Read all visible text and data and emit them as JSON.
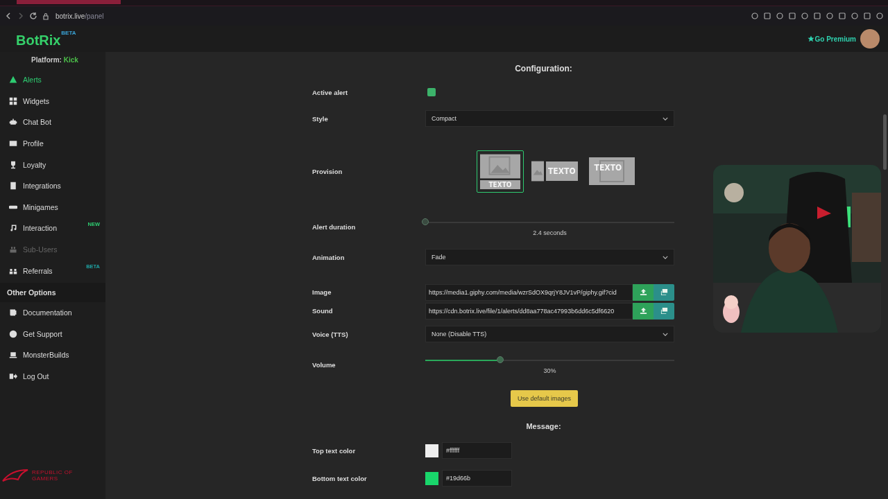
{
  "browser": {
    "url_host": "botrix.live",
    "url_path": "/panel"
  },
  "header": {
    "logo": "BotRix",
    "logo_badge": "BETA",
    "premium": "Go Premium"
  },
  "sidebar": {
    "platform_label": "Platform:",
    "platform_value": "Kick",
    "items": [
      {
        "label": "Alerts",
        "selected": true,
        "disabled": false
      },
      {
        "label": "Widgets",
        "selected": false,
        "disabled": false
      },
      {
        "label": "Chat Bot",
        "selected": false,
        "disabled": false
      },
      {
        "label": "Profile",
        "selected": false,
        "disabled": false
      },
      {
        "label": "Loyalty",
        "selected": false,
        "disabled": false
      },
      {
        "label": "Integrations",
        "selected": false,
        "disabled": false
      },
      {
        "label": "Minigames",
        "selected": false,
        "disabled": false
      },
      {
        "label": "Interaction",
        "selected": false,
        "disabled": false,
        "badge": "NEW",
        "color": "#2ecc71"
      },
      {
        "label": "Sub-Users",
        "selected": false,
        "disabled": true
      },
      {
        "label": "Referrals",
        "selected": false,
        "disabled": false,
        "badge": "BETA",
        "color": "#1fa3a3"
      }
    ],
    "section_title": "Other Options",
    "other_items": [
      {
        "label": "Documentation"
      },
      {
        "label": "Get Support"
      },
      {
        "label": "MonsterBuilds"
      },
      {
        "label": "Log Out"
      }
    ]
  },
  "form": {
    "title": "Configuration:",
    "rows": [
      {
        "kind": "toggle",
        "label": "Active alert",
        "checked": true
      },
      {
        "kind": "select",
        "label": "Style",
        "value": "Compact"
      },
      {
        "kind": "provision",
        "label": "Provision",
        "options": [
          {
            "kind": "stacked",
            "text": "TEXTO",
            "selected": true
          },
          {
            "kind": "side",
            "text": "TEXTO",
            "selected": false
          },
          {
            "kind": "overlay",
            "text": "TEXTO",
            "selected": false
          }
        ]
      },
      {
        "kind": "slider",
        "label": "Alert duration",
        "level": 0,
        "reading": "2.4 seconds"
      },
      {
        "kind": "select",
        "label": "Animation",
        "value": "Fade"
      },
      {
        "kind": "url",
        "label": "Image",
        "value": "https://media1.giphy.com/media/wzrSdOX9qrjY8JV1vP/giphy.gif?cid"
      },
      {
        "kind": "url",
        "label": "Sound",
        "value": "https://cdn.botrix.live/file/1/alerts/dd8aa778ac47993b6dd6c5df6620"
      },
      {
        "kind": "select",
        "label": "Voice (TTS)",
        "value": "None (Disable TTS)"
      },
      {
        "kind": "slider",
        "label": "Volume",
        "level": 0.3,
        "reading": "30%"
      },
      {
        "kind": "button",
        "label": "Use default images"
      },
      {
        "kind": "heading",
        "label": "Message:"
      },
      {
        "kind": "color",
        "label": "Top text color",
        "value": "#ffffff",
        "color": "#eeeeee"
      },
      {
        "kind": "color",
        "label": "Bottom text color",
        "value": "#19d66b",
        "color": "#19d66b"
      }
    ]
  },
  "overlay_logo": {
    "text": "REPUBLIC OF GAMERS"
  }
}
